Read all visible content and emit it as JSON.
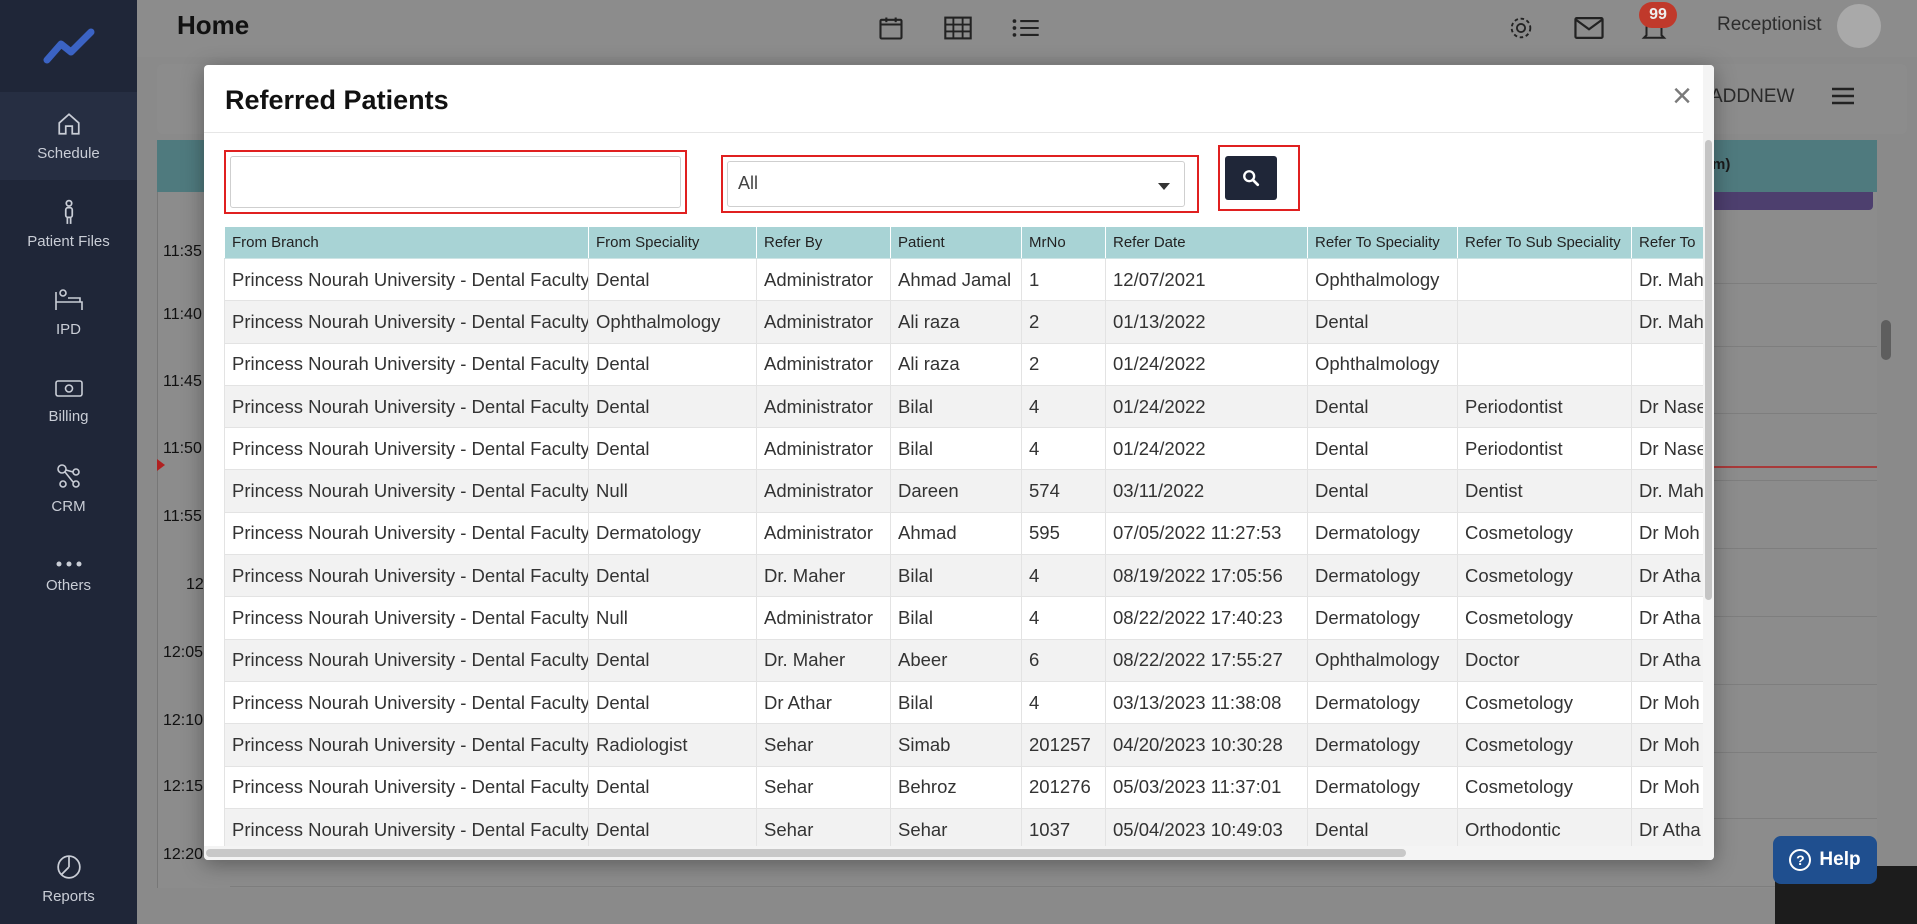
{
  "sidebar": {
    "items": [
      {
        "label": "Schedule",
        "icon": "home-icon"
      },
      {
        "label": "Patient Files",
        "icon": "person-icon"
      },
      {
        "label": "IPD",
        "icon": "bed-icon"
      },
      {
        "label": "Billing",
        "icon": "money-icon"
      },
      {
        "label": "CRM",
        "icon": "network-icon"
      },
      {
        "label": "Others",
        "icon": "dots-icon"
      }
    ],
    "bottom": {
      "label": "Reports",
      "icon": "pie-chart-icon"
    }
  },
  "header": {
    "title": "Home",
    "notification_count": "99",
    "role": "Receptionist"
  },
  "background": {
    "addnew_label": "ADDNEW",
    "column_fragment": "m)",
    "times": [
      "11:35",
      "11:40",
      "11:45",
      "11:50",
      "11:55",
      "12",
      "12:05",
      "12:10",
      "12:15",
      "12:20"
    ]
  },
  "help": {
    "label": "Help"
  },
  "modal": {
    "title": "Referred Patients",
    "close_symbol": "×",
    "search_value": "",
    "filter_selected": "All",
    "columns": [
      "From Branch",
      "From Speciality",
      "Refer By",
      "Patient",
      "MrNo",
      "Refer Date",
      "Refer To Speciality",
      "Refer To Sub Speciality",
      "Refer To"
    ],
    "rows": [
      [
        "Princess Nourah University - Dental Faculty",
        "Dental",
        "Administrator",
        "Ahmad Jamal",
        "1",
        "12/07/2021",
        "Ophthalmology",
        "",
        "Dr. Mah"
      ],
      [
        "Princess Nourah University - Dental Faculty",
        "Ophthalmology",
        "Administrator",
        "Ali raza",
        "2",
        "01/13/2022",
        "Dental",
        "",
        "Dr. Mah"
      ],
      [
        "Princess Nourah University - Dental Faculty",
        "Dental",
        "Administrator",
        "Ali raza",
        "2",
        "01/24/2022",
        "Ophthalmology",
        "",
        ""
      ],
      [
        "Princess Nourah University - Dental Faculty",
        "Dental",
        "Administrator",
        "Bilal",
        "4",
        "01/24/2022",
        "Dental",
        "Periodontist",
        "Dr Nase"
      ],
      [
        "Princess Nourah University - Dental Faculty",
        "Dental",
        "Administrator",
        "Bilal",
        "4",
        "01/24/2022",
        "Dental",
        "Periodontist",
        "Dr Nase"
      ],
      [
        "Princess Nourah University - Dental Faculty",
        "Null",
        "Administrator",
        "Dareen",
        "574",
        "03/11/2022",
        "Dental",
        "Dentist",
        "Dr. Mah"
      ],
      [
        "Princess Nourah University - Dental Faculty",
        "Dermatology",
        "Administrator",
        "Ahmad",
        "595",
        "07/05/2022 11:27:53",
        "Dermatology",
        "Cosmetology",
        "Dr Moh"
      ],
      [
        "Princess Nourah University - Dental Faculty",
        "Dental",
        "Dr. Maher",
        "Bilal",
        "4",
        "08/19/2022 17:05:56",
        "Dermatology",
        "Cosmetology",
        "Dr Atha"
      ],
      [
        "Princess Nourah University - Dental Faculty",
        "Null",
        "Administrator",
        "Bilal",
        "4",
        "08/22/2022 17:40:23",
        "Dermatology",
        "Cosmetology",
        "Dr Atha"
      ],
      [
        "Princess Nourah University - Dental Faculty",
        "Dental",
        "Dr. Maher",
        "Abeer",
        "6",
        "08/22/2022 17:55:27",
        "Ophthalmology",
        "Doctor",
        "Dr Atha"
      ],
      [
        "Princess Nourah University - Dental Faculty",
        "Dental",
        "Dr Athar",
        "Bilal",
        "4",
        "03/13/2023 11:38:08",
        "Dermatology",
        "Cosmetology",
        "Dr Moh"
      ],
      [
        "Princess Nourah University - Dental Faculty",
        "Radiologist",
        "Sehar",
        "Simab",
        "201257",
        "04/20/2023 10:30:28",
        "Dermatology",
        "Cosmetology",
        "Dr Moh"
      ],
      [
        "Princess Nourah University - Dental Faculty",
        "Dental",
        "Sehar",
        "Behroz",
        "201276",
        "05/03/2023 11:37:01",
        "Dermatology",
        "Cosmetology",
        "Dr Moh"
      ],
      [
        "Princess Nourah University - Dental Faculty",
        "Dental",
        "Sehar",
        "Sehar",
        "1037",
        "05/04/2023 10:49:03",
        "Dental",
        "Orthodontic",
        "Dr Atha"
      ]
    ]
  },
  "colors": {
    "sidebar_bg": "#1f2638",
    "table_header": "#a8d3d5",
    "highlight_border": "#e02020",
    "search_button": "#1f2638",
    "help_button": "#1f4f8f"
  }
}
